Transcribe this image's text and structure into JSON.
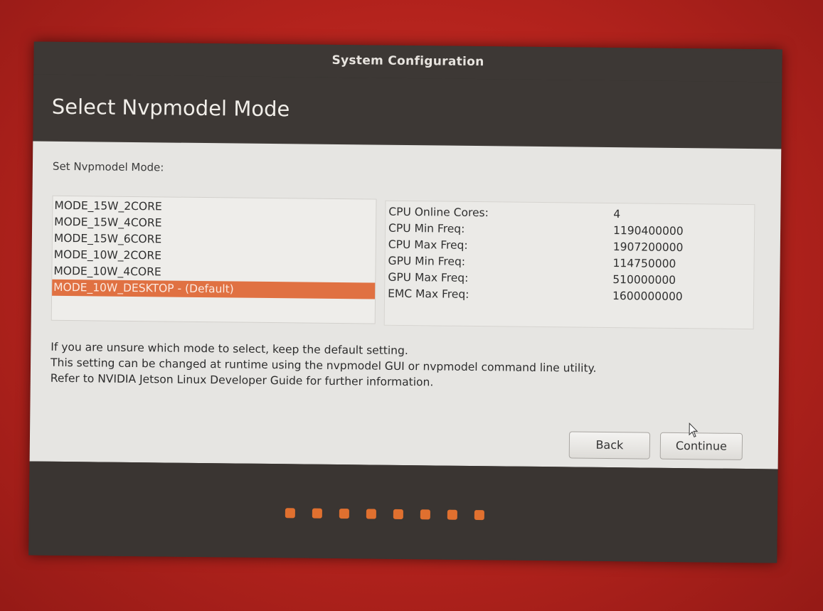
{
  "window": {
    "title": "System Configuration"
  },
  "page": {
    "title": "Select Nvpmodel Mode",
    "prompt": "Set Nvpmodel Mode:"
  },
  "modes": [
    {
      "label": "MODE_15W_2CORE",
      "selected": false
    },
    {
      "label": "MODE_15W_4CORE",
      "selected": false
    },
    {
      "label": "MODE_15W_6CORE",
      "selected": false
    },
    {
      "label": "MODE_10W_2CORE",
      "selected": false
    },
    {
      "label": "MODE_10W_4CORE",
      "selected": false
    },
    {
      "label": "MODE_10W_DESKTOP - (Default)",
      "selected": true
    }
  ],
  "details": [
    {
      "key": "CPU Online Cores:",
      "value": "4"
    },
    {
      "key": "CPU Min Freq:",
      "value": "1190400000"
    },
    {
      "key": "CPU Max Freq:",
      "value": "1907200000"
    },
    {
      "key": "GPU Min Freq:",
      "value": "114750000"
    },
    {
      "key": "GPU Max Freq:",
      "value": "510000000"
    },
    {
      "key": "EMC Max Freq:",
      "value": "1600000000"
    }
  ],
  "info": {
    "line1": "If you are unsure which mode to select, keep the default setting.",
    "line2": "This setting can be changed at runtime using the nvpmodel GUI or nvpmodel command line utility.",
    "line3": "Refer to NVIDIA Jetson Linux Developer Guide for further information."
  },
  "buttons": {
    "back": "Back",
    "continue": "Continue"
  },
  "progress": {
    "step_count": 8
  },
  "colors": {
    "accent": "#e07142",
    "header_bg": "#3d3835",
    "content_bg": "#e6e5e2"
  }
}
